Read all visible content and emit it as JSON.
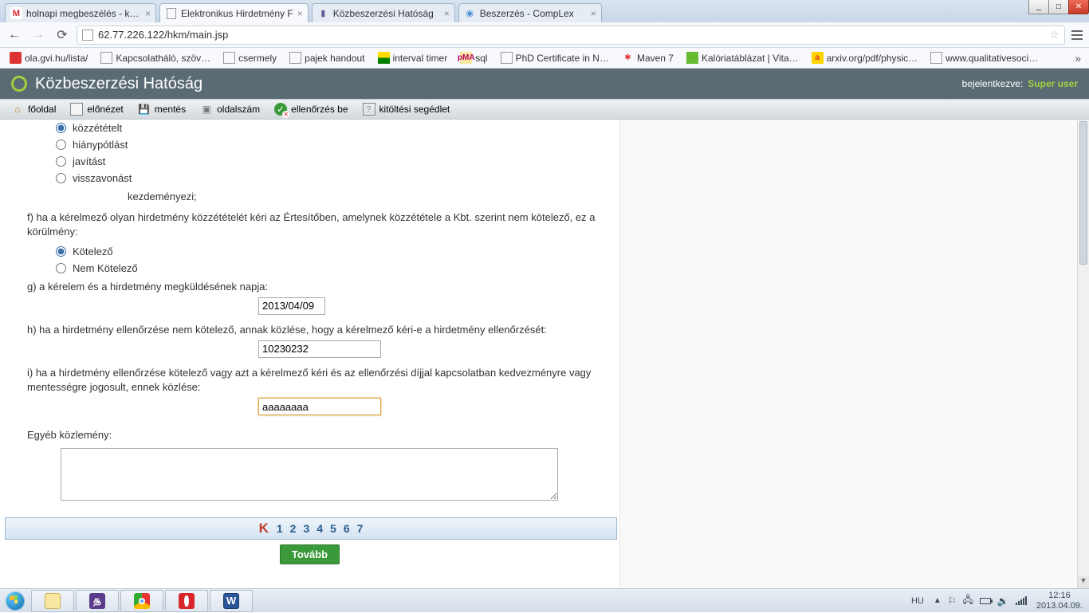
{
  "window": {
    "min": "_",
    "max": "□",
    "close": "✕"
  },
  "tabs": [
    {
      "title": "holnapi megbeszélés - kin…",
      "icon": "gmail"
    },
    {
      "title": "Elektronikus Hirdetmény F",
      "icon": "page",
      "active": true
    },
    {
      "title": "Közbeszerzési Hatóság",
      "icon": "kh"
    },
    {
      "title": "Beszerzés - CompLex",
      "icon": "globe"
    }
  ],
  "url": "62.77.226.122/hkm/main.jsp",
  "bookmarks": [
    {
      "label": "ola.gvi.hu/lista/",
      "icon": "red"
    },
    {
      "label": "Kapcsolatháló, szöv…",
      "icon": "page"
    },
    {
      "label": "csermely",
      "icon": "page"
    },
    {
      "label": "pajek handout",
      "icon": "page"
    },
    {
      "label": "interval timer",
      "icon": "flag"
    },
    {
      "label": "sql",
      "icon": "pma"
    },
    {
      "label": "PhD Certificate in N…",
      "icon": "page"
    },
    {
      "label": "Maven 7",
      "icon": "mav"
    },
    {
      "label": "Kalóriatáblázat | Vita…",
      "icon": "kal"
    },
    {
      "label": "arxiv.org/pdf/physic…",
      "icon": "arx"
    },
    {
      "label": "www.qualitativesoci…",
      "icon": "page"
    }
  ],
  "app": {
    "title": "Közbeszerzési Hatóság",
    "login_label": "bejelentkezve:",
    "user": "Super user"
  },
  "toolbar": {
    "home": "főoldal",
    "preview": "előnézet",
    "save": "mentés",
    "pagecount": "oldalszám",
    "check": "ellenőrzés be",
    "help": "kitöltési segédlet"
  },
  "form": {
    "r_kozzetetelt": "közzétételt",
    "r_hianypotlast": "hiánypótlást",
    "r_javitast": "javítást",
    "r_visszavonast": "visszavonást",
    "kezdemenyezi": "kezdeményezi;",
    "f_text": "f) ha a kérelmező olyan hirdetmény közzétételét kéri az Értesítőben, amelynek közzététele a Kbt. szerint nem kötelező, ez a körülmény:",
    "r_kotelezo": "Kötelező",
    "r_nemkotelezo": "Nem Kötelező",
    "g_text": "g) a kérelem és a hirdetmény megküldésének napja:",
    "g_value": "2013/04/09",
    "h_text": "h) ha a hirdetmény ellenőrzése nem kötelező, annak közlése, hogy a kérelmező kéri-e a hirdetmény ellenőrzését:",
    "h_value": "10230232",
    "i_text": "i) ha a hirdetmény ellenőrzése kötelező vagy azt a kérelmező kéri és az ellenőrzési díjjal kapcsolatban kedvezményre vagy mentességre jogosult, ennek közlése:",
    "i_value": "aaaaaaaa",
    "other_label": "Egyéb közlemény:",
    "other_value": ""
  },
  "pager": {
    "k": "K",
    "pages": [
      "1",
      "2",
      "3",
      "4",
      "5",
      "6",
      "7"
    ]
  },
  "next": "Tovább",
  "tray": {
    "lang": "HU",
    "time": "12:16",
    "date": "2013.04.09."
  }
}
